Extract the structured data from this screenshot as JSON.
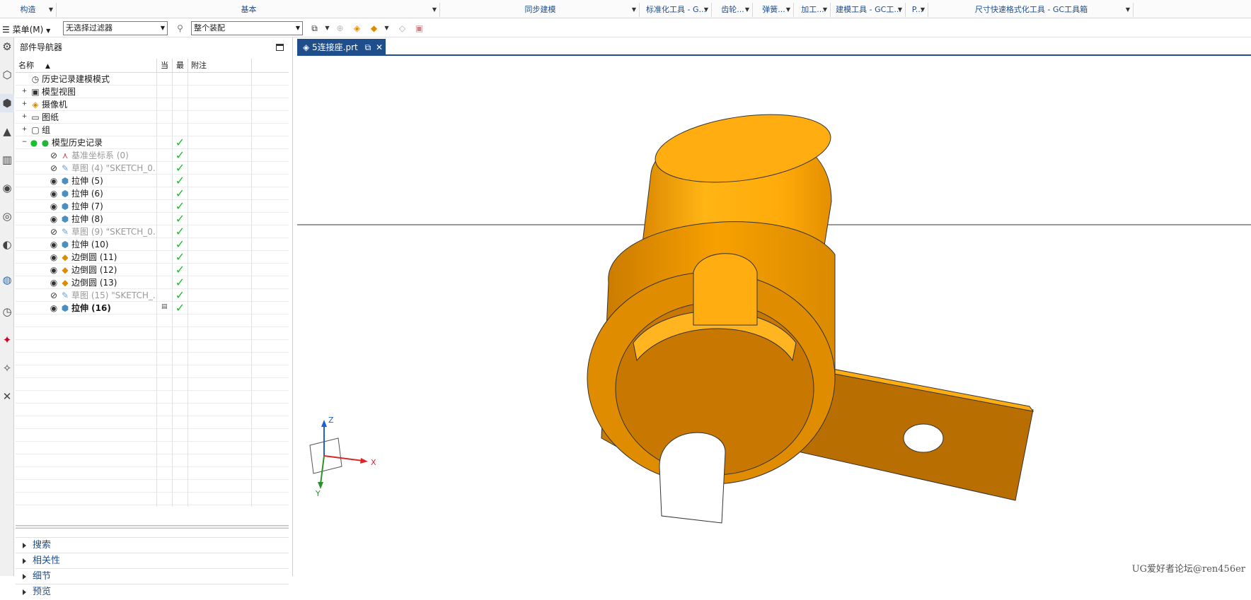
{
  "ribbon": {
    "groups": [
      {
        "label": "构造"
      },
      {
        "label": "基本"
      },
      {
        "label": "同步建模"
      },
      {
        "label": "标准化工具 - G..."
      },
      {
        "label": "齿轮..."
      },
      {
        "label": "弹簧..."
      },
      {
        "label": "加工..."
      },
      {
        "label": "建模工具 - GC工..."
      },
      {
        "label": "P..."
      },
      {
        "label": "尺寸快速格式化工具 - GC工具箱"
      }
    ]
  },
  "toolbar": {
    "menu_label": "菜单(M)",
    "filter_value": "无选择过滤器",
    "scope_value": "整个装配"
  },
  "navigator": {
    "title": "部件导航器",
    "columns": {
      "name": "名称",
      "current": "当",
      "latest": "最",
      "comment": "附注"
    },
    "rows": [
      {
        "label": "历史记录建模模式",
        "icon": "clock-icon",
        "expand": "",
        "level": 0,
        "gray": false,
        "bold": false,
        "check": false,
        "current": ""
      },
      {
        "label": "模型视图",
        "icon": "model-views-icon",
        "expand": "+",
        "level": 0,
        "gray": false,
        "bold": false,
        "check": false,
        "current": ""
      },
      {
        "label": "摄像机",
        "icon": "camera-icon",
        "expand": "+",
        "level": 0,
        "gray": false,
        "bold": false,
        "check": false,
        "current": ""
      },
      {
        "label": "图纸",
        "icon": "drawing-icon",
        "expand": "+",
        "level": 0,
        "gray": false,
        "bold": false,
        "check": false,
        "current": ""
      },
      {
        "label": "组",
        "icon": "group-icon",
        "expand": "+",
        "level": 0,
        "gray": false,
        "bold": false,
        "check": false,
        "current": ""
      },
      {
        "label": "模型历史记录",
        "icon": "model-history-icon",
        "expand": "−",
        "level": 0,
        "gray": false,
        "bold": false,
        "check": true,
        "current": ""
      },
      {
        "label": "基准坐标系 (0)",
        "icon": "datum-csys-icon",
        "expand": "",
        "level": 1,
        "gray": true,
        "bold": false,
        "check": true,
        "current": ""
      },
      {
        "label": "草图 (4) \"SKETCH_0...",
        "icon": "sketch-icon",
        "expand": "",
        "level": 1,
        "gray": true,
        "bold": false,
        "check": true,
        "current": ""
      },
      {
        "label": "拉伸 (5)",
        "icon": "extrude-icon",
        "expand": "",
        "level": 1,
        "gray": false,
        "bold": false,
        "check": true,
        "current": ""
      },
      {
        "label": "拉伸 (6)",
        "icon": "extrude-icon",
        "expand": "",
        "level": 1,
        "gray": false,
        "bold": false,
        "check": true,
        "current": ""
      },
      {
        "label": "拉伸 (7)",
        "icon": "extrude-icon",
        "expand": "",
        "level": 1,
        "gray": false,
        "bold": false,
        "check": true,
        "current": ""
      },
      {
        "label": "拉伸 (8)",
        "icon": "extrude-icon",
        "expand": "",
        "level": 1,
        "gray": false,
        "bold": false,
        "check": true,
        "current": ""
      },
      {
        "label": "草图 (9) \"SKETCH_0...",
        "icon": "sketch-icon",
        "expand": "",
        "level": 1,
        "gray": true,
        "bold": false,
        "check": true,
        "current": ""
      },
      {
        "label": "拉伸 (10)",
        "icon": "extrude-icon",
        "expand": "",
        "level": 1,
        "gray": false,
        "bold": false,
        "check": true,
        "current": ""
      },
      {
        "label": "边倒圆 (11)",
        "icon": "edge-blend-icon",
        "expand": "",
        "level": 1,
        "gray": false,
        "bold": false,
        "check": true,
        "current": ""
      },
      {
        "label": "边倒圆 (12)",
        "icon": "edge-blend-icon",
        "expand": "",
        "level": 1,
        "gray": false,
        "bold": false,
        "check": true,
        "current": ""
      },
      {
        "label": "边倒圆 (13)",
        "icon": "edge-blend-icon",
        "expand": "",
        "level": 1,
        "gray": false,
        "bold": false,
        "check": true,
        "current": ""
      },
      {
        "label": "草图 (15) \"SKETCH_...",
        "icon": "sketch-icon",
        "expand": "",
        "level": 1,
        "gray": true,
        "bold": false,
        "check": true,
        "current": ""
      },
      {
        "label": "拉伸 (16)",
        "icon": "extrude-icon",
        "expand": "",
        "level": 1,
        "gray": false,
        "bold": true,
        "check": true,
        "current": "current-feature-icon"
      }
    ],
    "sections": [
      {
        "label": "搜索"
      },
      {
        "label": "相关性"
      },
      {
        "label": "细节"
      },
      {
        "label": "预览"
      }
    ]
  },
  "graphics": {
    "tab_label": "5连接座.prt",
    "axis_x": "X",
    "axis_y": "Y",
    "axis_z": "Z",
    "watermark": "UG爱好者论坛@ren456er",
    "colors": {
      "part_light": "#ffb10f",
      "part_mid": "#f39a05",
      "part_dark": "#b66c00",
      "accent": "#1f4e8c"
    }
  }
}
